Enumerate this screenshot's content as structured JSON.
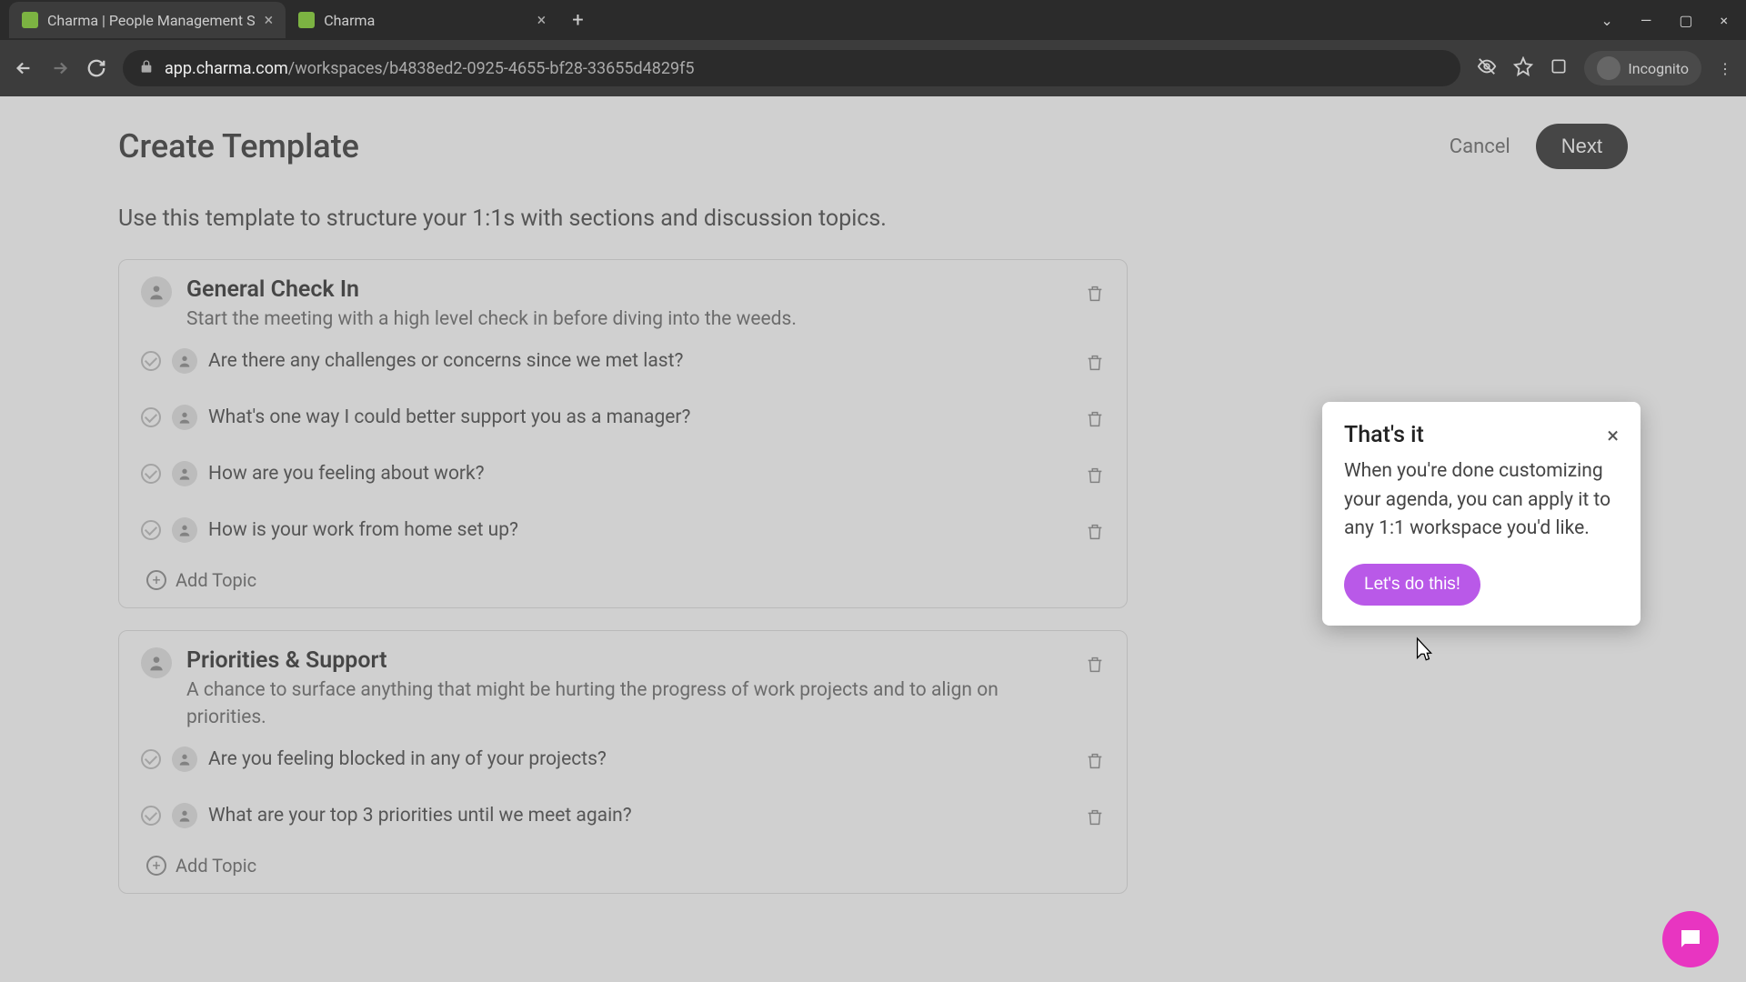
{
  "browser": {
    "tabs": [
      {
        "title": "Charma | People Management S"
      },
      {
        "title": "Charma"
      }
    ],
    "url_host": "app.charma.com",
    "url_path": "/workspaces/b4838ed2-0925-4655-bf28-33655d4829f5",
    "incognito_label": "Incognito"
  },
  "header": {
    "title": "Create Template",
    "cancel_label": "Cancel",
    "next_label": "Next"
  },
  "subtitle": "Use this template to structure your 1:1s with sections and discussion topics.",
  "sections": [
    {
      "title": "General Check In",
      "desc": "Start the meeting with a high level check in before diving into the weeds.",
      "topics": [
        "Are there any challenges or concerns since we met last?",
        "What's one way I could better support you as a manager?",
        "How are you feeling about work?",
        "How is your work from home set up?"
      ],
      "add_label": "Add Topic"
    },
    {
      "title": "Priorities & Support",
      "desc": "A chance to surface anything that might be hurting the progress of work projects and to align on priorities.",
      "topics": [
        "Are you feeling blocked in any of your projects?",
        "What are your top 3 priorities until we meet again?"
      ],
      "add_label": "Add Topic"
    }
  ],
  "popover": {
    "title": "That's it",
    "body": "When you're done customizing your agenda, you can apply it to any 1:1 workspace you'd like.",
    "button_label": "Let's do this!"
  }
}
